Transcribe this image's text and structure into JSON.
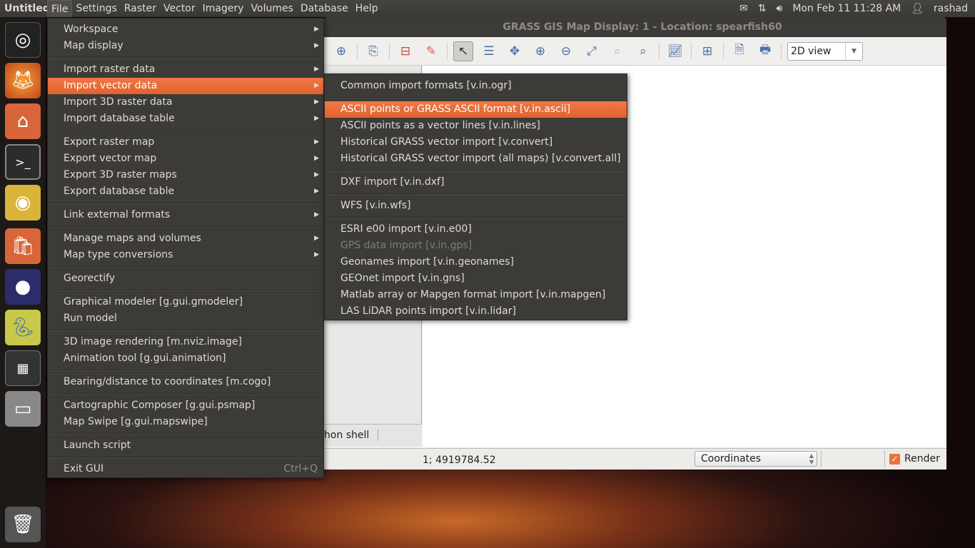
{
  "panel": {
    "app_title": "Untitled",
    "menus": [
      "File",
      "Settings",
      "Raster",
      "Vector",
      "Imagery",
      "Volumes",
      "Database",
      "Help"
    ],
    "clock": "Mon Feb 11 11:28 AM",
    "user": "rashad",
    "indicators": [
      "mail-icon",
      "network-icon",
      "volume-icon"
    ]
  },
  "launcher": {
    "items": [
      "ubuntu-dash",
      "firefox",
      "files",
      "terminal",
      "chrome",
      "software-center",
      "eclipse",
      "python",
      "workspace-switcher",
      "disk",
      "trash"
    ]
  },
  "window": {
    "title": "GRASS GIS Map Display: 1  - Location: spearfish60",
    "view_mode": "2D view",
    "tab_label": "hon shell",
    "coordinates": "1; 4919784.52",
    "status_mode": "Coordinates",
    "render_label": "Render",
    "render_checked": true
  },
  "file_menu": [
    {
      "label": "Workspace",
      "submenu": true
    },
    {
      "label": "Map display",
      "submenu": true
    },
    {
      "sep": true
    },
    {
      "label": "Import raster data",
      "submenu": true
    },
    {
      "label": "Import vector data",
      "submenu": true,
      "highlighted": true
    },
    {
      "label": "Import 3D raster data",
      "submenu": true
    },
    {
      "label": "Import database table",
      "submenu": true
    },
    {
      "sep": true
    },
    {
      "label": "Export raster map",
      "submenu": true
    },
    {
      "label": "Export vector map",
      "submenu": true
    },
    {
      "label": "Export 3D raster maps",
      "submenu": true
    },
    {
      "label": "Export database table",
      "submenu": true
    },
    {
      "sep": true
    },
    {
      "label": "Link external formats",
      "submenu": true
    },
    {
      "sep": true
    },
    {
      "label": "Manage maps and volumes",
      "submenu": true
    },
    {
      "label": "Map type conversions",
      "submenu": true
    },
    {
      "sep": true
    },
    {
      "label": "Georectify"
    },
    {
      "sep": true
    },
    {
      "label": "Graphical modeler  [g.gui.gmodeler]"
    },
    {
      "label": "Run model"
    },
    {
      "sep": true
    },
    {
      "label": "3D image rendering  [m.nviz.image]"
    },
    {
      "label": "Animation tool  [g.gui.animation]"
    },
    {
      "sep": true
    },
    {
      "label": "Bearing/distance to coordinates  [m.cogo]"
    },
    {
      "sep": true
    },
    {
      "label": "Cartographic Composer  [g.gui.psmap]"
    },
    {
      "label": "Map Swipe  [g.gui.mapswipe]"
    },
    {
      "sep": true
    },
    {
      "label": "Launch script"
    },
    {
      "sep": true
    },
    {
      "label": "Exit GUI",
      "accel": "Ctrl+Q"
    }
  ],
  "vector_submenu": [
    {
      "label": "Common import formats  [v.in.ogr]"
    },
    {
      "sep": true
    },
    {
      "label": "ASCII points or GRASS ASCII format  [v.in.ascii]",
      "highlighted": true
    },
    {
      "label": "ASCII points as a vector lines  [v.in.lines]"
    },
    {
      "label": "Historical GRASS vector import  [v.convert]"
    },
    {
      "label": "Historical GRASS vector import (all maps)  [v.convert.all]"
    },
    {
      "sep": true
    },
    {
      "label": "DXF import  [v.in.dxf]"
    },
    {
      "sep": true
    },
    {
      "label": "WFS  [v.in.wfs]"
    },
    {
      "sep": true
    },
    {
      "label": "ESRI e00 import  [v.in.e00]"
    },
    {
      "label": "GPS data import  [v.in.gps]",
      "disabled": true
    },
    {
      "label": "Geonames import  [v.in.geonames]"
    },
    {
      "label": "GEOnet import  [v.in.gns]"
    },
    {
      "label": "Matlab array or Mapgen format import  [v.in.mapgen]"
    },
    {
      "label": "LAS LiDAR points import  [v.in.lidar]"
    }
  ],
  "colors": {
    "accent": "#e9683a",
    "panel": "#3c3b37",
    "menu_text": "#dfdbd2"
  }
}
